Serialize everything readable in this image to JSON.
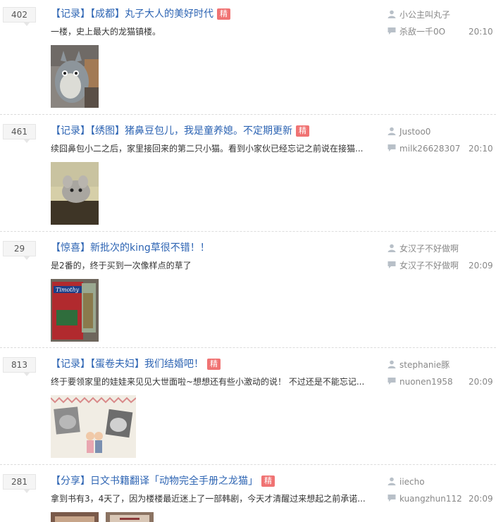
{
  "threads": [
    {
      "reply_count": "402",
      "title": "【记录】【成都】丸子大人的美好时代",
      "featured": true,
      "featured_label": "精",
      "abstract": "一楼，史上最大的龙猫镇楼。",
      "author": "小公主叫丸子",
      "last_replier": "杀敌一千0O",
      "time": "20:10",
      "images": [
        "totoro-plush-photo"
      ]
    },
    {
      "reply_count": "461",
      "title": "【记录】【绣图】猪鼻豆包儿，我是童养媳。不定期更新",
      "featured": true,
      "featured_label": "精",
      "abstract": "续囧鼻包小二之后，家里接回来的第二只小猫。看到小家伙已经忘记之前说在接猫...",
      "author": "Justoo0",
      "last_replier": "milk26628307",
      "time": "20:10",
      "images": [
        "chinchilla-photo"
      ]
    },
    {
      "reply_count": "29",
      "title": "【惊喜】新批次的king草很不错！！",
      "featured": false,
      "featured_label": "",
      "abstract": "是2番的，终于买到一次像样点的草了",
      "author": "女汉子不好做啊",
      "last_replier": "女汉子不好做啊",
      "time": "20:09",
      "images": [
        "timothy-hay-bag-photo"
      ]
    },
    {
      "reply_count": "813",
      "title": "【记录】【蛋卷夫妇】我们结婚吧！",
      "featured": true,
      "featured_label": "精",
      "abstract": "终于要领家里的娃娃来见见大世面啦~想想还有些小激动的说！ 不过还是不能忘记...",
      "author": "stephanie豚",
      "last_replier": "nuonen1958",
      "time": "20:09",
      "images": [
        "wedding-card-photo"
      ]
    },
    {
      "reply_count": "281",
      "title": "【分享】日文书籍翻译「动物完全手册之龙猫」",
      "featured": true,
      "featured_label": "精",
      "abstract": "拿到书有3，4天了，因为楼楼最近迷上了一部韩剧，今天才清醒过来想起之前承诺...",
      "author": "iiecho",
      "last_replier": "kuangzhun112",
      "time": "20:09",
      "images": [
        "book-cover-photo-1",
        "book-cover-photo-2"
      ]
    }
  ],
  "colors": {
    "link": "#2d64b3",
    "featured_badge": "#f07373",
    "meta": "#888888"
  },
  "icons": {
    "author": "person-icon",
    "last_reply": "comment-icon"
  }
}
